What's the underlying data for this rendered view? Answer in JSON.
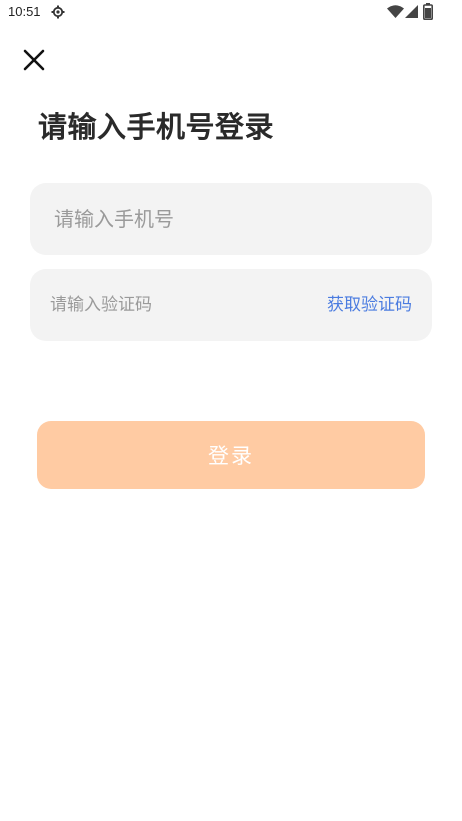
{
  "status_bar": {
    "time": "10:51",
    "icons": [
      "settings-icon",
      "wifi-icon",
      "signal-icon",
      "battery-icon"
    ]
  },
  "header": {
    "close_icon": "close-icon",
    "title": "请输入手机号登录"
  },
  "form": {
    "phone_placeholder": "请输入手机号",
    "phone_value": "",
    "code_placeholder": "请输入验证码",
    "code_value": "",
    "get_code_label": "获取验证码",
    "login_label": "登录"
  },
  "colors": {
    "field_bg": "#f3f3f3",
    "link": "#4b7ce0",
    "login_button_disabled": "#ffcba3"
  }
}
